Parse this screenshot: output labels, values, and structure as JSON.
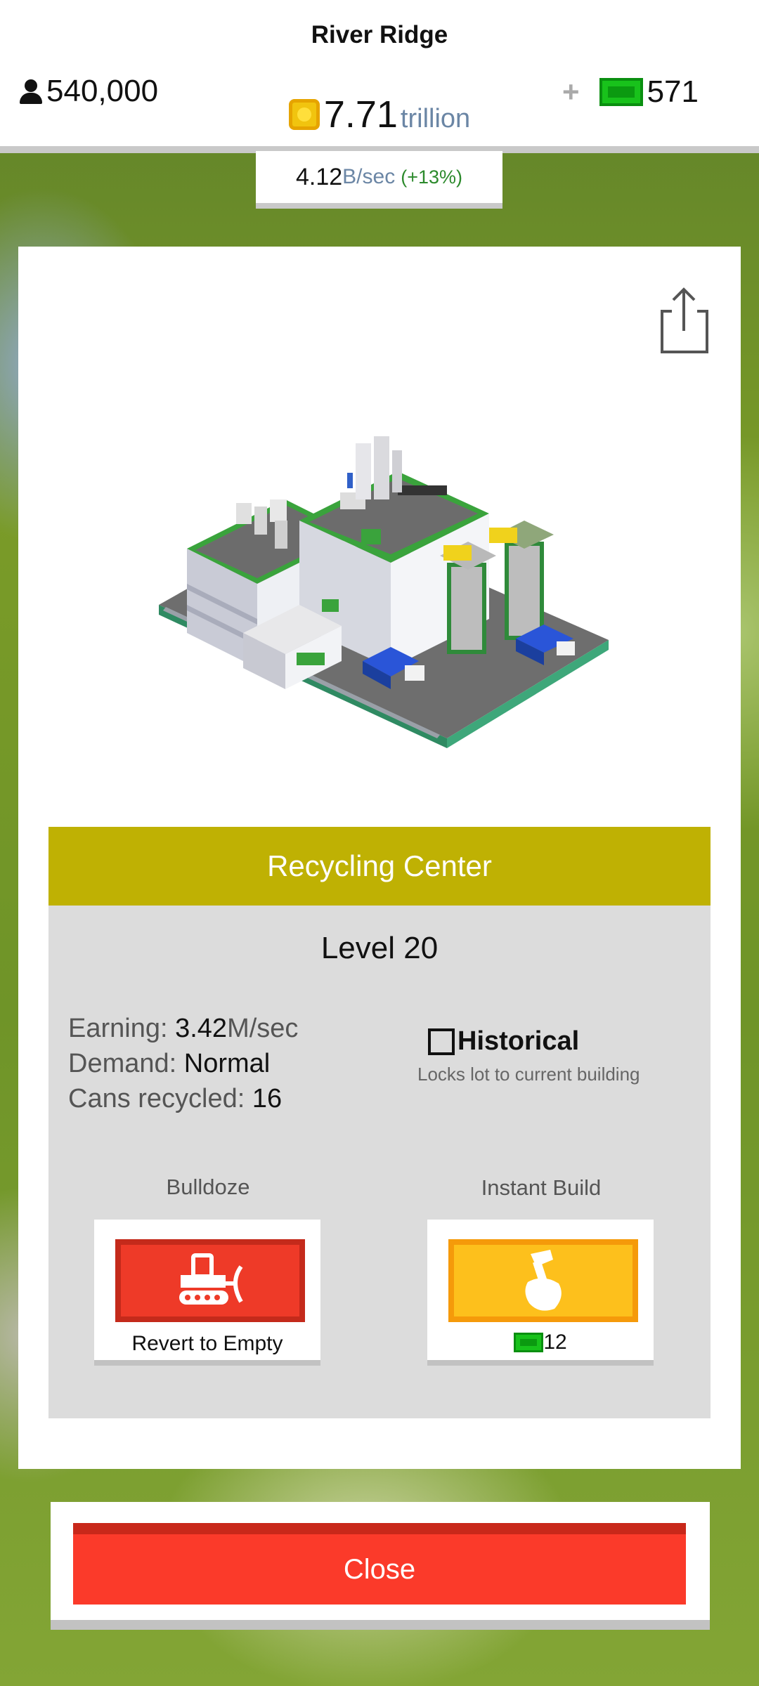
{
  "header": {
    "city_name": "River Ridge",
    "population": "540,000",
    "money": {
      "value": "7.71",
      "unit": "trillion"
    },
    "cash": "571",
    "income": {
      "value": "4.12",
      "unit": "B/sec",
      "change": "(+13%)"
    }
  },
  "building": {
    "name": "Recycling Center",
    "level_label": "Level 20",
    "stats": {
      "earning_label": "Earning: ",
      "earning_value": "3.42",
      "earning_unit": "M/sec",
      "demand_label": "Demand: ",
      "demand_value": "Normal",
      "cans_label": "Cans recycled: ",
      "cans_value": "16"
    },
    "historical": {
      "label": "Historical",
      "description": "Locks lot to current building",
      "checked": false
    }
  },
  "actions": {
    "bulldoze": {
      "title": "Bulldoze",
      "caption": "Revert to Empty",
      "icon": "bulldozer-icon"
    },
    "instant_build": {
      "title": "Instant Build",
      "cost": "12",
      "icon": "hammer-icon"
    }
  },
  "footer": {
    "close_label": "Close"
  },
  "colors": {
    "title_banner": "#bfb103",
    "bulldoze": "#ee3a28",
    "instant_build": "#fdc01c",
    "close": "#fb3a2a",
    "cash": "#18c21b"
  }
}
